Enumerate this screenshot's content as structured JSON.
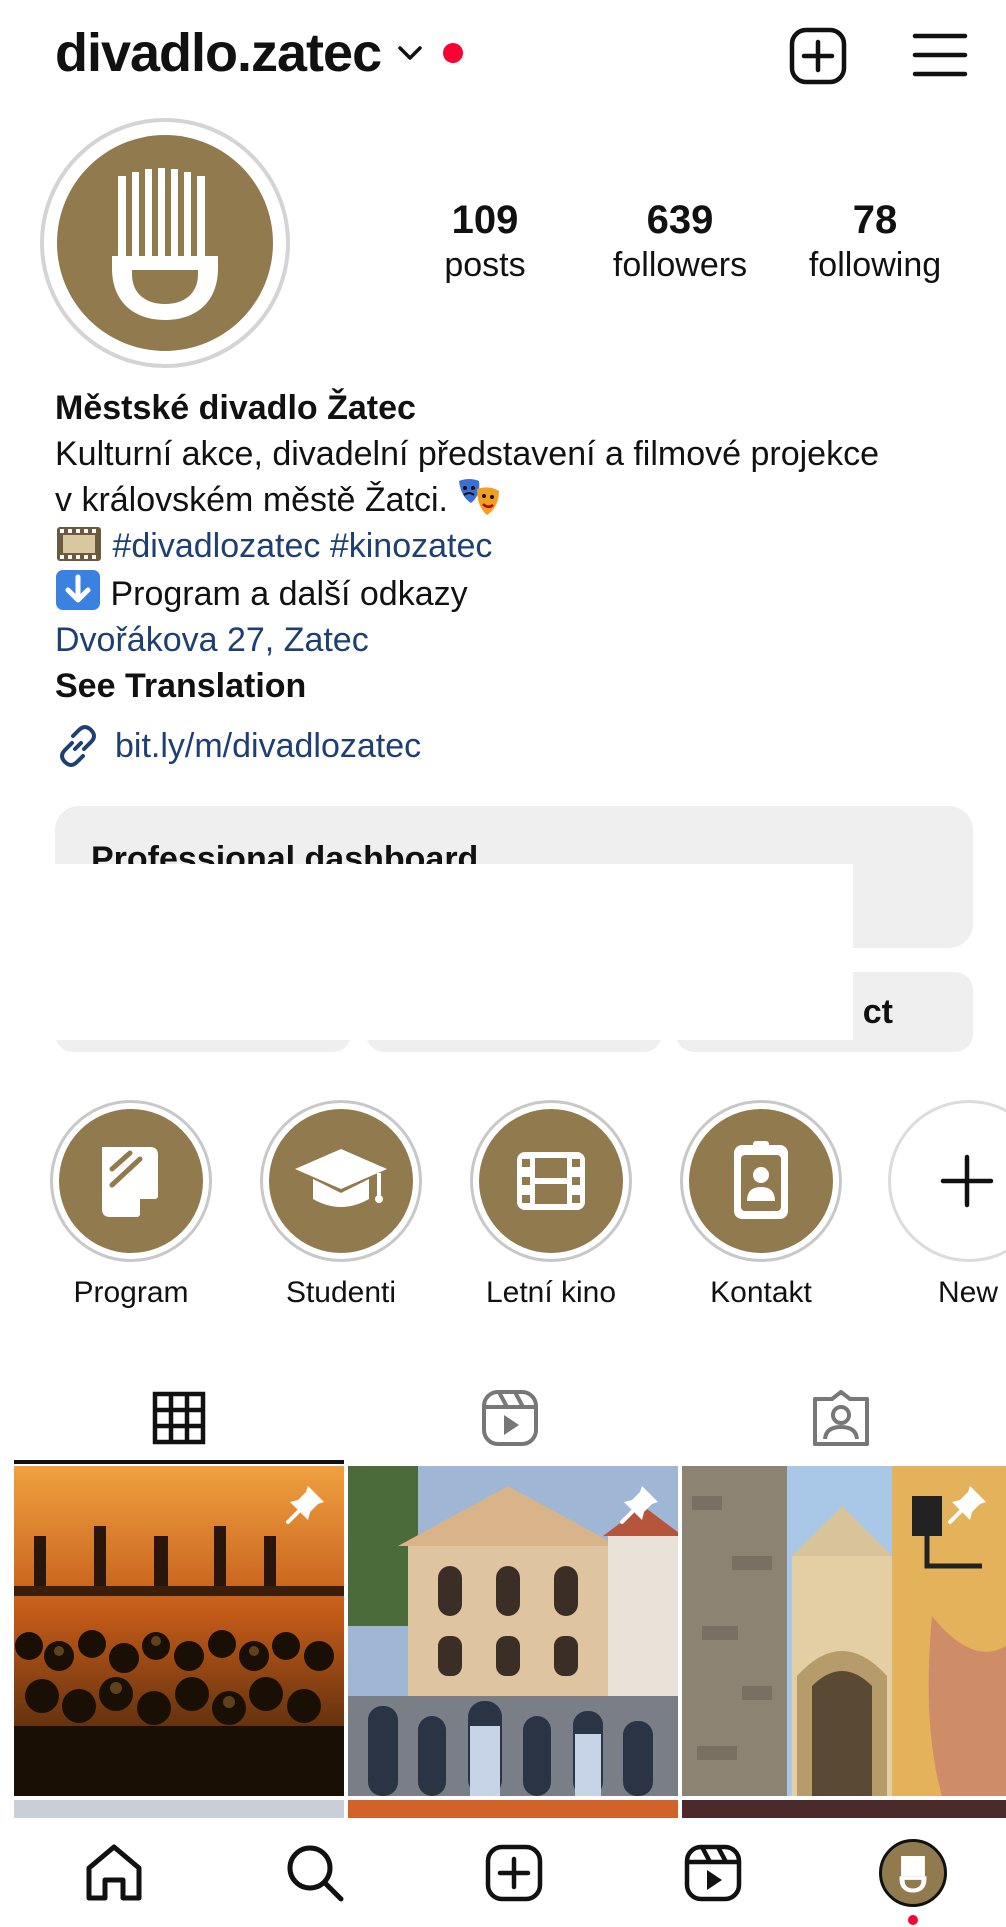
{
  "colors": {
    "brand": "#917a4d",
    "link": "#1d3f72",
    "notification": "#ff0033",
    "button_bg": "#efefef"
  },
  "header": {
    "username": "divadlo.zatec"
  },
  "stats": [
    {
      "value": "109",
      "label": "posts"
    },
    {
      "value": "639",
      "label": "followers"
    },
    {
      "value": "78",
      "label": "following"
    }
  ],
  "bio": {
    "name": "Městské divadlo Žatec",
    "text_line1": "Kulturní akce, divadelní představení a filmové projekce",
    "text_line2": "v královském městě Žatci.",
    "hashtags": "#divadlozatec #kinozatec",
    "program_line": "Program a další odkazy",
    "address": "Dvořákova 27, Zatec",
    "see_translation": "See Translation",
    "url": "bit.ly/m/divadlozatec"
  },
  "dashboard": {
    "title": "Professional dashboard"
  },
  "buttons": {
    "contact_partial": "ct"
  },
  "highlights": [
    {
      "label": "Program",
      "icon": "note-icon"
    },
    {
      "label": "Studenti",
      "icon": "graduation-cap-icon"
    },
    {
      "label": "Letní kino",
      "icon": "film-icon"
    },
    {
      "label": "Kontakt",
      "icon": "contact-card-icon"
    },
    {
      "label": "New",
      "icon": "plus-icon"
    }
  ],
  "tabs": [
    "grid",
    "reels",
    "tagged"
  ],
  "nav": [
    "home",
    "search",
    "create",
    "reels",
    "profile"
  ]
}
